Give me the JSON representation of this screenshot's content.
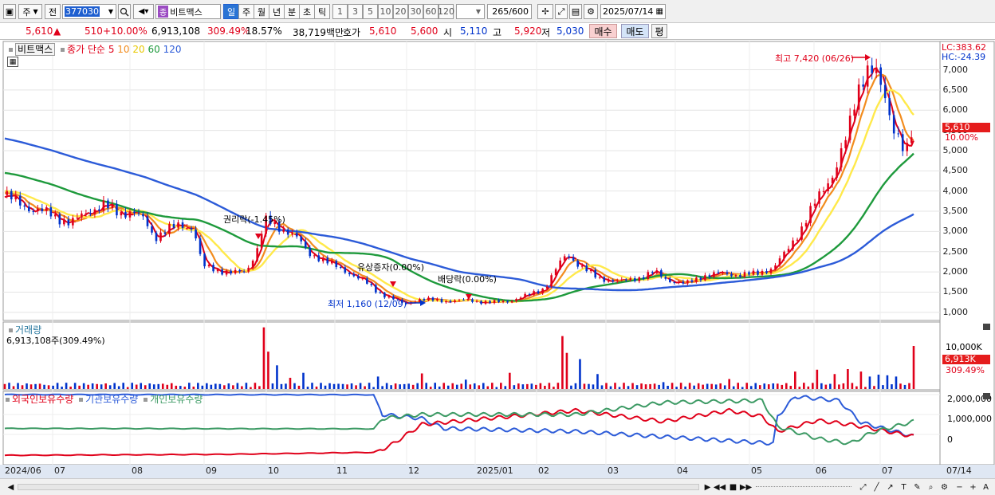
{
  "toolbar": {
    "market_label": "주",
    "prev_label": "전",
    "code": "377030",
    "stock_name": "비트맥스",
    "stock_badge": "종",
    "periods": [
      "일",
      "주",
      "월",
      "년",
      "분",
      "초",
      "틱"
    ],
    "active_period": "일",
    "intervals": [
      "1",
      "3",
      "5",
      "10",
      "20",
      "30",
      "60",
      "120"
    ],
    "count": "265",
    "count_total": "/600",
    "date": "2025/07/14"
  },
  "quote": {
    "price": "5,610",
    "change_arrow": "▲",
    "change": "510",
    "change_pct": "+10.00%",
    "volume": "6,913,108",
    "volume_pct": "309.49%",
    "turnover": "18.57%",
    "trade_value": "38,719백만",
    "bid_label": "호가",
    "bid": "5,610",
    "ask": "5,600",
    "open_label": "시",
    "open": "5,110",
    "high_label": "고",
    "high": "5,920",
    "low_label": "저",
    "low": "5,030",
    "buy_label": "매수",
    "sell_label": "매도",
    "p_label": "평"
  },
  "colors": {
    "up": "#e0001a",
    "down": "#0033cc",
    "ma5": "#e0001a",
    "ma10": "#f28c1e",
    "ma20": "#ffe94a",
    "ma60": "#1e9a3c",
    "ma120": "#2c5bd8",
    "foreign": "#e0001a",
    "institution": "#2c5bd8",
    "individual": "#3c9a64"
  },
  "legend": {
    "stock": "비트맥스",
    "price_series": "종가 단순",
    "ma": [
      "5",
      "10",
      "20",
      "60",
      "120"
    ]
  },
  "right_info": {
    "lc": "LC:383.62",
    "hc": "HC:-24.39",
    "price_tag": "5,610",
    "price_pct": "10.00%"
  },
  "annotations": {
    "high": "최고 7,420 (06/26)",
    "low": "최저 1,160 (12/09)",
    "rights": "권리락(-1.45%)",
    "capital": "유상증자(0.00%)",
    "dividend": "배당락(0.00%)"
  },
  "volume_panel": {
    "title": "거래량",
    "value": "6,913,108주(309.49%)",
    "axis": "10,000K",
    "tag": "6,913K",
    "tag_pct": "309.49%"
  },
  "holdings_panel": {
    "series": [
      "외국인보유수량",
      "기관보유수량",
      "개인보유수량"
    ],
    "axis": [
      "2,000,000",
      "1,000,000",
      "0"
    ]
  },
  "x_axis": [
    "2024/06",
    "07",
    "08",
    "09",
    "10",
    "11",
    "12",
    "2025/01",
    "02",
    "03",
    "04",
    "05",
    "06",
    "07"
  ],
  "x_axis_right": "07/14",
  "chart_data": {
    "type": "candlestick",
    "y_ticks": [
      "7,000",
      "6,500",
      "6,000",
      "5,500",
      "5,000",
      "4,500",
      "4,000",
      "3,500",
      "3,000",
      "2,500",
      "2,000",
      "1,500",
      "1,000"
    ],
    "ylim": [
      800,
      7700
    ],
    "close_points": [
      [
        0,
        3900
      ],
      [
        10,
        3600
      ],
      [
        20,
        3450
      ],
      [
        30,
        3200
      ],
      [
        38,
        3500
      ],
      [
        45,
        3650
      ],
      [
        52,
        3450
      ],
      [
        58,
        3500
      ],
      [
        64,
        3250
      ],
      [
        68,
        2850
      ],
      [
        74,
        3050
      ],
      [
        80,
        3150
      ],
      [
        86,
        3100
      ],
      [
        90,
        2150
      ],
      [
        96,
        2050
      ],
      [
        104,
        1980
      ],
      [
        110,
        2000
      ],
      [
        116,
        2700
      ],
      [
        118,
        3300
      ],
      [
        124,
        3100
      ],
      [
        130,
        3000
      ],
      [
        134,
        2800
      ],
      [
        138,
        2450
      ],
      [
        144,
        2350
      ],
      [
        150,
        2150
      ],
      [
        158,
        1950
      ],
      [
        164,
        1750
      ],
      [
        170,
        1500
      ],
      [
        176,
        1350
      ],
      [
        182,
        1200
      ],
      [
        188,
        1320
      ],
      [
        196,
        1300
      ],
      [
        204,
        1280
      ],
      [
        212,
        1300
      ],
      [
        220,
        1240
      ],
      [
        230,
        1280
      ],
      [
        238,
        1420
      ],
      [
        246,
        1600
      ],
      [
        252,
        2150
      ],
      [
        256,
        2450
      ],
      [
        262,
        2150
      ],
      [
        270,
        1850
      ],
      [
        280,
        1760
      ],
      [
        290,
        1870
      ],
      [
        296,
        2000
      ],
      [
        302,
        1800
      ],
      [
        310,
        1700
      ],
      [
        318,
        1900
      ],
      [
        326,
        1960
      ],
      [
        334,
        1930
      ],
      [
        342,
        1950
      ],
      [
        350,
        2100
      ],
      [
        356,
        2500
      ],
      [
        362,
        3000
      ],
      [
        368,
        3600
      ],
      [
        374,
        4150
      ],
      [
        378,
        4500
      ],
      [
        384,
        5400
      ],
      [
        388,
        6400
      ],
      [
        392,
        7050
      ],
      [
        396,
        7000
      ],
      [
        398,
        6700
      ],
      [
        402,
        6100
      ],
      [
        404,
        5700
      ],
      [
        408,
        5300
      ],
      [
        410,
        4900
      ],
      [
        412,
        5100
      ],
      [
        414,
        5610
      ]
    ],
    "volume_k": [
      [
        0,
        800
      ],
      [
        20,
        600
      ],
      [
        40,
        900
      ],
      [
        60,
        700
      ],
      [
        80,
        500
      ],
      [
        100,
        600
      ],
      [
        118,
        9900
      ],
      [
        120,
        6000
      ],
      [
        124,
        3800
      ],
      [
        130,
        1800
      ],
      [
        136,
        2600
      ],
      [
        150,
        800
      ],
      [
        170,
        2000
      ],
      [
        190,
        2500
      ],
      [
        210,
        1500
      ],
      [
        230,
        2600
      ],
      [
        254,
        8500
      ],
      [
        256,
        5800
      ],
      [
        262,
        4800
      ],
      [
        270,
        2400
      ],
      [
        300,
        1100
      ],
      [
        330,
        1600
      ],
      [
        350,
        900
      ],
      [
        360,
        2800
      ],
      [
        370,
        3100
      ],
      [
        378,
        2400
      ],
      [
        384,
        3200
      ],
      [
        390,
        2800
      ],
      [
        394,
        2000
      ],
      [
        398,
        2300
      ],
      [
        402,
        2200
      ],
      [
        406,
        2000
      ],
      [
        414,
        6913
      ]
    ]
  }
}
